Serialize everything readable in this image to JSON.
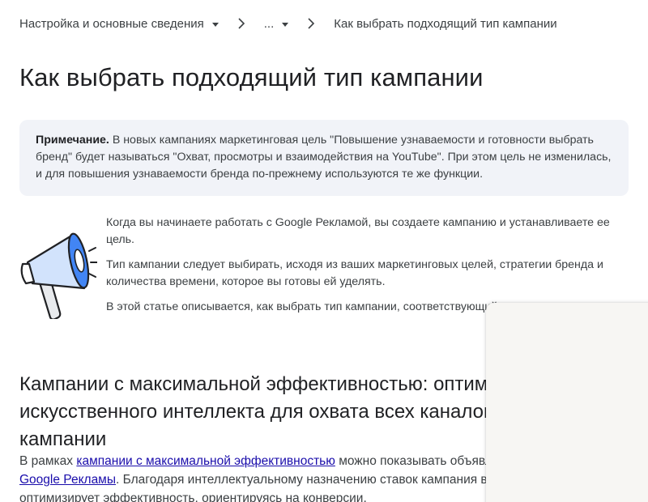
{
  "breadcrumb": {
    "root_label": "Настройка и основные сведения",
    "ellipsis_label": "...",
    "current_label": "Как выбрать подходящий тип кампании"
  },
  "page": {
    "title": "Как выбрать подходящий тип кампании"
  },
  "note": {
    "label": "Примечание.",
    "text": " В новых кампаниях маркетинговая цель \"Повышение узнаваемости и готовности выбрать бренд\" будет называться \"Охват, просмотры и взаимодействия на YouTube\". При этом цель не изменилась, и для повышения узнаваемости бренда по-прежнему используются те же функции."
  },
  "intro": {
    "paragraphs": [
      "Когда вы начинаете работать с Google Рекламой, вы создаете кампанию и устанавливаете ее цель.",
      "Тип кампании следует выбирать, исходя из ваших маркетинговых целей, стратегии бренда и количества времени, которое вы готовы ей уделять.",
      "В этой статье описывается, как выбрать тип кампании, соответствующий вашим целям."
    ]
  },
  "section": {
    "title": "Кампании с максимальной эффективностью: оптимизация на основе искусственного интеллекта для охвата всех каналов в рамках одной кампании",
    "body_prefix": "В рамках ",
    "link1": "кампании с максимальной эффективностью",
    "body_mid1": " можно показывать объявления по всем ",
    "link2": "инвентаре Google Рекламы",
    "body_rest": ". Благодаря интеллектуальному назначению ставок кампания в режиме реального времени оптимизирует эффективность, ориентируясь на конверсии."
  },
  "colors": {
    "link": "#1a0dab",
    "note_background": "#f1f3f8",
    "megaphone_accent": "#4285f4"
  },
  "icons": {
    "megaphone": "megaphone-illustration",
    "breadcrumb_separator": "chevron-right-icon",
    "dropdown": "caret-down-icon"
  }
}
